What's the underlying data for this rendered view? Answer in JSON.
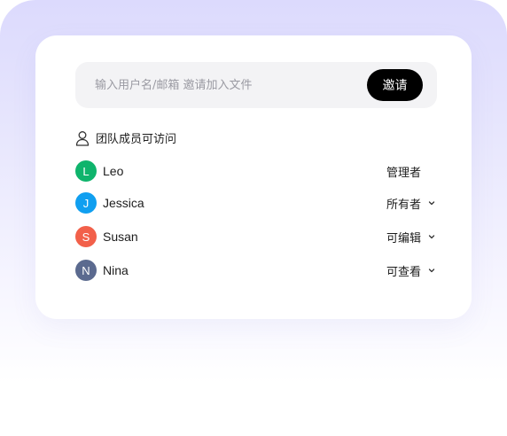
{
  "invite": {
    "placeholder": "输入用户名/邮箱 邀请加入文件",
    "button_label": "邀请"
  },
  "team": {
    "header": "团队成员可访问",
    "members": [
      {
        "initial": "L",
        "name": "Leo",
        "role": "管理者",
        "avatar_color": "#0fb46c",
        "has_dropdown": false
      },
      {
        "initial": "J",
        "name": "Jessica",
        "role": "所有者",
        "avatar_color": "#109ff0",
        "has_dropdown": true
      },
      {
        "initial": "S",
        "name": "Susan",
        "role": "可编辑",
        "avatar_color": "#f2604a",
        "has_dropdown": true
      },
      {
        "initial": "N",
        "name": "Nina",
        "role": "可查看",
        "avatar_color": "#5b6a8f",
        "has_dropdown": true
      }
    ]
  },
  "icons": {
    "team_header": "user-icon",
    "role_dropdown": "chevron-down-icon"
  },
  "colors": {
    "accent_button": "#000000",
    "background_top": "#dcdafd"
  }
}
